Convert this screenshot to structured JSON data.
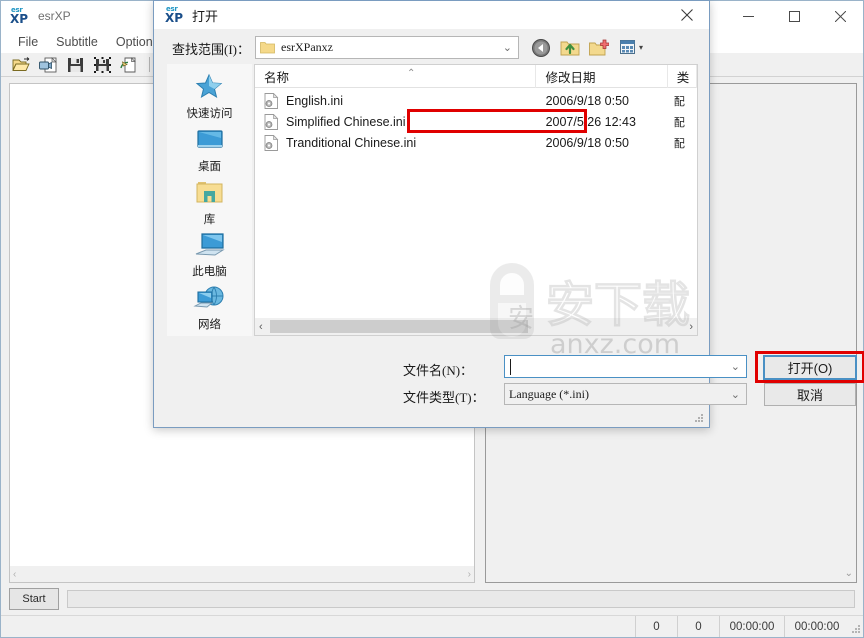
{
  "app": {
    "title": "esrXP",
    "icon": "esrxp-logo-icon",
    "logo_top": "esr",
    "logo_bottom": "XP",
    "menus": [
      {
        "label": "File",
        "name": "menu-file"
      },
      {
        "label": "Subtitle",
        "name": "menu-subtitle"
      },
      {
        "label": "Option",
        "name": "menu-option"
      }
    ],
    "toolbar": [
      {
        "name": "open-file-icon",
        "title": "Open"
      },
      {
        "name": "import-video-icon",
        "title": "Import"
      },
      {
        "name": "save-icon",
        "title": "Save"
      },
      {
        "name": "save-as-icon",
        "title": "Save As"
      },
      {
        "name": "export-icon",
        "title": "Export"
      },
      {
        "name": "video-settings-icon",
        "title": "Video"
      }
    ],
    "window_controls": {
      "minimize": "—",
      "maximize": "□",
      "close": "✕"
    },
    "start_button": "Start",
    "status": {
      "count_1": "0",
      "count_2": "0",
      "time_1": "00:00:00",
      "time_2": "00:00:00"
    }
  },
  "dialog": {
    "title": "打开",
    "icon": "esrxp-logo-icon",
    "close_glyph": "✕",
    "lookin": {
      "label": "查找范围(I)：",
      "value": "esrXPanxz",
      "caret": "⌄",
      "folder_icon": "folder-icon"
    },
    "nav_buttons": [
      {
        "name": "back-arrow-icon",
        "title": "返回"
      },
      {
        "name": "up-folder-icon",
        "title": "上一级"
      },
      {
        "name": "new-folder-icon",
        "title": "新建文件夹"
      },
      {
        "name": "view-mode-icon",
        "title": "视图"
      }
    ],
    "view_caret": "▾",
    "places": [
      {
        "label": "快速访问",
        "icon": "quick-access-star-icon",
        "name": "place-quick-access"
      },
      {
        "label": "桌面",
        "icon": "desktop-icon",
        "name": "place-desktop"
      },
      {
        "label": "库",
        "icon": "library-folder-icon",
        "name": "place-library"
      },
      {
        "label": "此电脑",
        "icon": "this-pc-icon",
        "name": "place-this-pc"
      },
      {
        "label": "网络",
        "icon": "network-icon",
        "name": "place-network"
      }
    ],
    "file_list": {
      "columns": [
        {
          "label": "名称",
          "name": "column-name"
        },
        {
          "label": "修改日期",
          "name": "column-date-modified"
        },
        {
          "label": "类",
          "name": "column-type"
        }
      ],
      "sort_caret": "⌃",
      "rows": [
        {
          "name": "English.ini",
          "date": "2006/9/18 0:50",
          "type": "配",
          "icon": "ini-file-icon",
          "highlighted": false
        },
        {
          "name": "Simplified Chinese.ini",
          "date": "2007/5/26 12:43",
          "type": "配",
          "icon": "ini-file-icon",
          "highlighted": true
        },
        {
          "name": "Tranditional Chinese.ini",
          "date": "2006/9/18 0:50",
          "type": "配",
          "icon": "ini-file-icon",
          "highlighted": false
        }
      ],
      "scroll_left": "‹",
      "scroll_right": "›"
    },
    "filename": {
      "label": "文件名(N)：",
      "value": "",
      "caret": "⌄"
    },
    "filetype": {
      "label": "文件类型(T)：",
      "value": "Language (*.ini)",
      "caret": "⌄"
    },
    "open_button": "打开(O)",
    "cancel_button": "取消"
  },
  "left_panel": {
    "scroll_left": "‹",
    "scroll_right": "›"
  },
  "right_panel": {
    "scroll_down": "⌄"
  },
  "watermark": {
    "text_cn": "安下载",
    "text_en": "anxz.com",
    "badge_char": "安"
  },
  "colors": {
    "highlight_red": "#e00000",
    "accent_blue": "#4a90c4",
    "window_border": "#9ab3c9",
    "folder_yellow": "#f5d98a",
    "selection_blue": "#cde8ff"
  }
}
